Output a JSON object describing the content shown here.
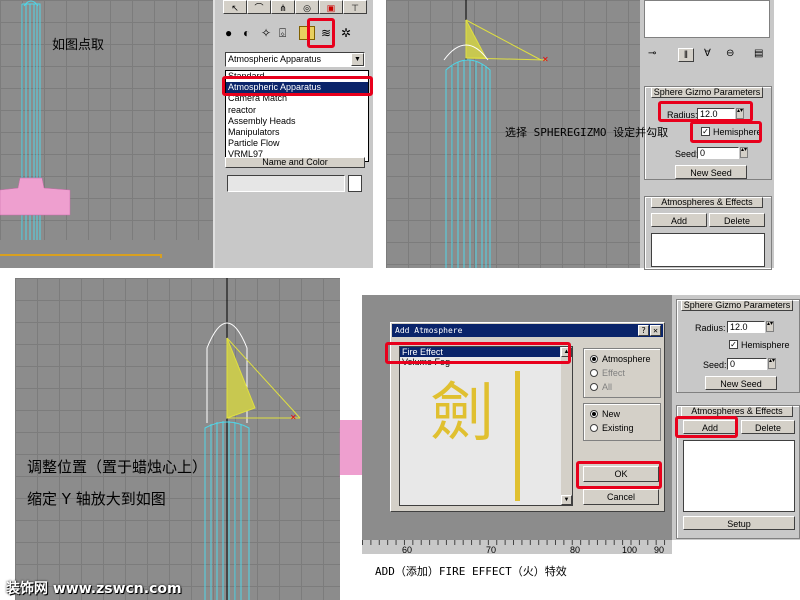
{
  "panel_tl": {
    "caption": "如图点取",
    "dropdown_selected": "Atmospheric Apparatus",
    "dropdown_items": [
      "Standard",
      "Atmospheric Apparatus",
      "Camera Match",
      "reactor",
      "Assembly Heads",
      "Manipulators",
      "Particle Flow",
      "VRML97"
    ],
    "name_color_label": "Name and Color"
  },
  "panel_tr": {
    "rollout_params": "Sphere Gizmo Parameters",
    "radius_label": "Radius:",
    "radius_value": "12.0",
    "hemisphere_label": "Hemisphere",
    "seed_label": "Seed:",
    "seed_value": "0",
    "new_seed": "New Seed",
    "rollout_atmos": "Atmospheres & Effects",
    "add": "Add",
    "delete": "Delete",
    "caption": "选择 SPHEREGIZMO 设定并勾取"
  },
  "panel_bl": {
    "caption_line1": "调整位置（置于蜡烛心上）",
    "caption_line2": "缩定 Y 轴放大到如图"
  },
  "dialog": {
    "title": "Add Atmosphere",
    "list": [
      "Fire Effect",
      "Volume Fog"
    ],
    "radio_group1": [
      "Atmosphere",
      "Effect",
      "All"
    ],
    "radio_group2": [
      "New",
      "Existing"
    ],
    "ok": "OK",
    "cancel": "Cancel",
    "watermark": "劍"
  },
  "panel_br": {
    "rollout_params": "Sphere Gizmo Parameters",
    "radius_label": "Radius:",
    "radius_value": "12.0",
    "hemisphere_label": "Hemisphere",
    "seed_label": "Seed:",
    "seed_value": "0",
    "new_seed": "New Seed",
    "rollout_atmos": "Atmospheres & Effects",
    "add": "Add",
    "delete": "Delete",
    "setup": "Setup",
    "ruler": [
      "60",
      "70",
      "80",
      "90",
      "100"
    ],
    "caption": "ADD（添加）FIRE EFFECT（火）特效"
  },
  "footer": {
    "watermark": "装饰网 www.zswcn.com"
  },
  "colors": {
    "highlight": "#e8001c",
    "selection": "#0a246a",
    "viewport": "#8c8c8c",
    "wire_cyan": "#4fd6e8",
    "gizmo_yellow": "#e0e040"
  }
}
